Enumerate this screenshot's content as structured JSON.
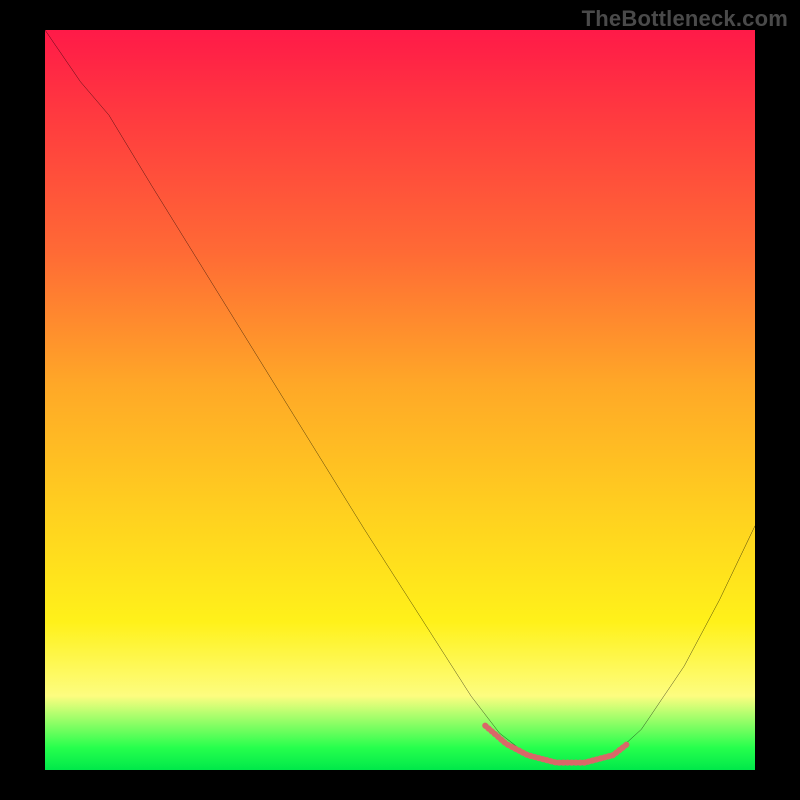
{
  "watermark": "TheBottleneck.com",
  "chart_data": {
    "type": "line",
    "title": "",
    "xlabel": "",
    "ylabel": "",
    "xlim": [
      0,
      100
    ],
    "ylim": [
      0,
      100
    ],
    "gradient_stops": [
      {
        "pos": 0,
        "color": "#ff1a48"
      },
      {
        "pos": 12,
        "color": "#ff3b3f"
      },
      {
        "pos": 30,
        "color": "#ff6a35"
      },
      {
        "pos": 48,
        "color": "#ffa827"
      },
      {
        "pos": 66,
        "color": "#ffd21f"
      },
      {
        "pos": 80,
        "color": "#fff11a"
      },
      {
        "pos": 90,
        "color": "#fdfd80"
      },
      {
        "pos": 97,
        "color": "#26ff4d"
      },
      {
        "pos": 100,
        "color": "#00e84a"
      }
    ],
    "series": [
      {
        "name": "bottleneck-curve",
        "color": "#000000",
        "stroke_width": 2.2,
        "points": [
          {
            "x": 0.0,
            "y": 100.0
          },
          {
            "x": 5.0,
            "y": 93.0
          },
          {
            "x": 9.0,
            "y": 88.5
          },
          {
            "x": 15.0,
            "y": 79.0
          },
          {
            "x": 25.0,
            "y": 63.5
          },
          {
            "x": 35.0,
            "y": 48.0
          },
          {
            "x": 45.0,
            "y": 32.5
          },
          {
            "x": 55.0,
            "y": 17.5
          },
          {
            "x": 60.0,
            "y": 10.0
          },
          {
            "x": 64.0,
            "y": 5.0
          },
          {
            "x": 68.0,
            "y": 2.0
          },
          {
            "x": 72.0,
            "y": 0.8
          },
          {
            "x": 76.0,
            "y": 0.8
          },
          {
            "x": 80.0,
            "y": 2.0
          },
          {
            "x": 84.0,
            "y": 5.5
          },
          {
            "x": 90.0,
            "y": 14.0
          },
          {
            "x": 95.0,
            "y": 23.0
          },
          {
            "x": 100.0,
            "y": 33.0
          }
        ]
      },
      {
        "name": "trough-highlight",
        "color": "#d96a6a",
        "stroke_width": 6,
        "dash": "2 12",
        "points": [
          {
            "x": 62.0,
            "y": 6.0
          },
          {
            "x": 65.0,
            "y": 3.5
          },
          {
            "x": 68.0,
            "y": 2.0
          },
          {
            "x": 72.0,
            "y": 1.0
          },
          {
            "x": 76.0,
            "y": 1.0
          },
          {
            "x": 80.0,
            "y": 2.0
          },
          {
            "x": 82.0,
            "y": 3.5
          }
        ]
      }
    ]
  }
}
